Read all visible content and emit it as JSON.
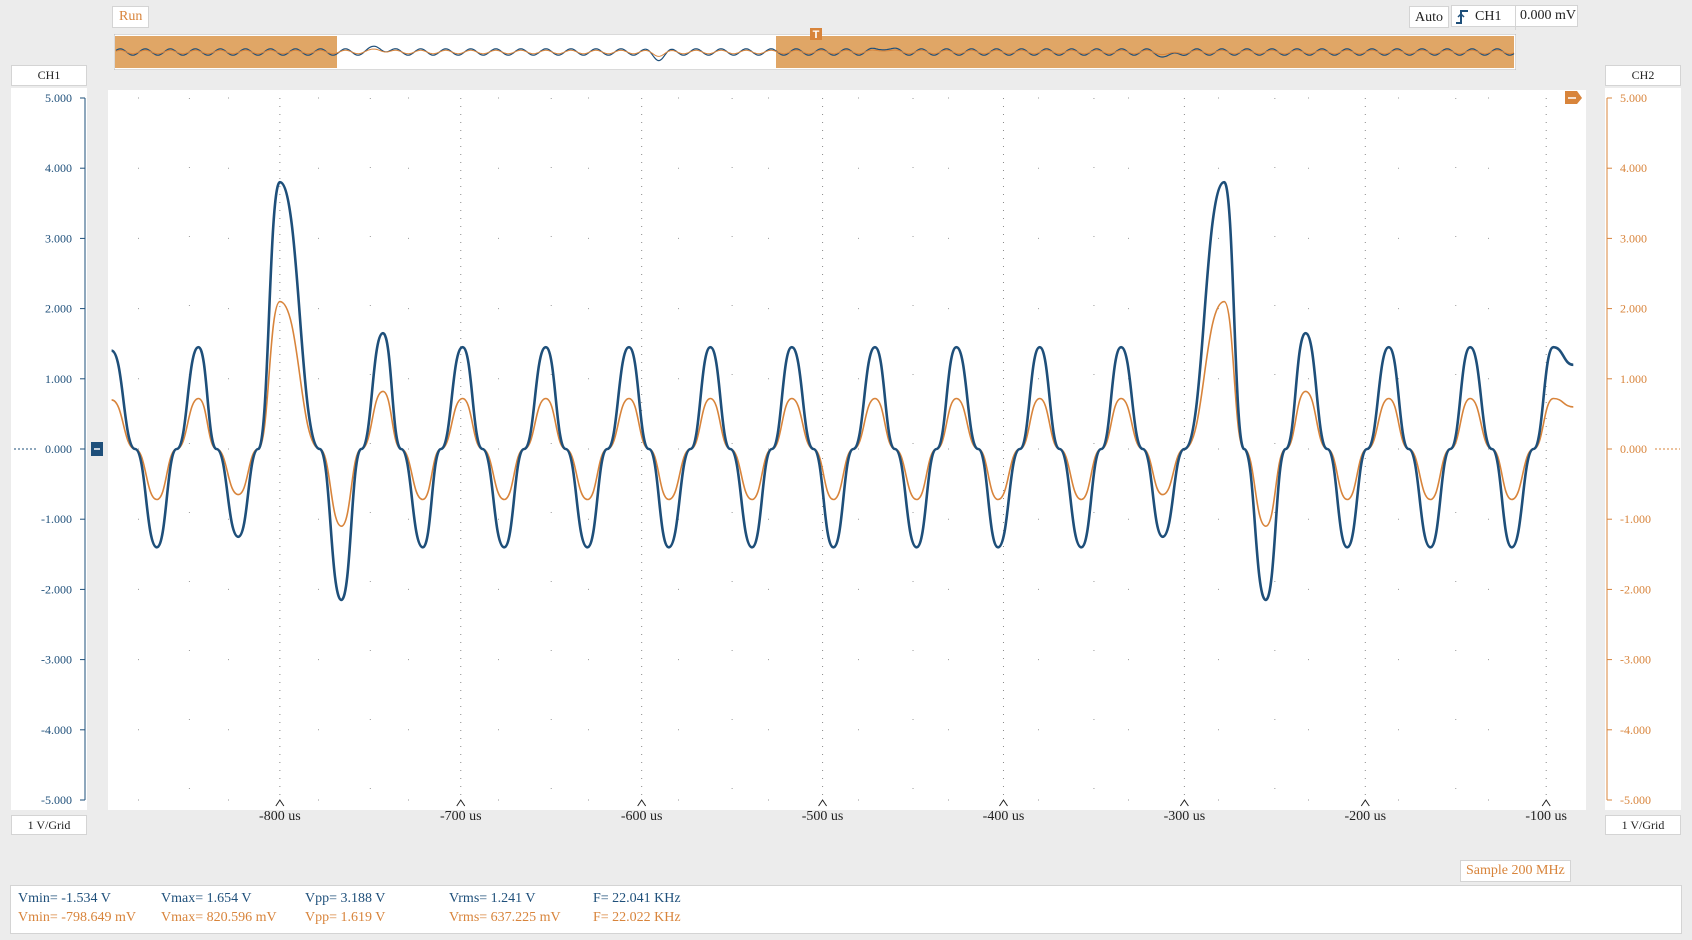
{
  "toolbar": {
    "run_state": "Run",
    "trigger_mode": "Auto",
    "trigger_source": "CH1",
    "trigger_level": "0.000 mV",
    "trigger_icon": "rising-edge-icon"
  },
  "channels": {
    "ch1": {
      "label": "CH1",
      "scale": "1 V/Grid",
      "color": "#1e4f7a"
    },
    "ch2": {
      "label": "CH2",
      "scale": "1 V/Grid",
      "color": "#d8843b"
    }
  },
  "sample_rate": "Sample 200 MHz",
  "measurements": {
    "ch1": {
      "vmin": "Vmin= -1.534 V",
      "vmax": "Vmax= 1.654 V",
      "vpp": "Vpp= 3.188 V",
      "vrms": "Vrms= 1.241 V",
      "freq": "F= 22.041 KHz"
    },
    "ch2": {
      "vmin": "Vmin= -798.649 mV",
      "vmax": "Vmax= 820.596 mV",
      "vpp": "Vpp= 1.619 V",
      "vrms": "Vrms= 637.225 mV",
      "freq": "F= 22.022 KHz"
    }
  },
  "markers": {
    "trigger_marker": "T"
  },
  "chart_data": {
    "type": "line",
    "title": "",
    "xlabel": "",
    "ylabel": "",
    "x_unit": "us",
    "y_unit": "V",
    "xlim": [
      -895,
      -78
    ],
    "ylim": [
      -5,
      5
    ],
    "x_ticks": [
      -800,
      -700,
      -600,
      -500,
      -400,
      -300,
      -200,
      -100
    ],
    "x_tick_labels": [
      "-800 us",
      "-700 us",
      "-600 us",
      "-500 us",
      "-400 us",
      "-300 us",
      "-200 us",
      "-100 us"
    ],
    "y_ticks": [
      5,
      4,
      3,
      2,
      1,
      0,
      -1,
      -2,
      -3,
      -4,
      -5
    ],
    "y_tick_labels": [
      "5.000",
      "4.000",
      "3.000",
      "2.000",
      "1.000",
      "0.000",
      "-1.000",
      "-2.000",
      "-3.000",
      "-4.000",
      "-5.000"
    ],
    "grid": true,
    "series": [
      {
        "name": "CH1",
        "color": "#1e4f7a",
        "x": [
          -893,
          -880,
          -868,
          -857,
          -845,
          -835,
          -823,
          -812,
          -800,
          -778,
          -766,
          -755,
          -743,
          -733,
          -721,
          -711,
          -699,
          -688,
          -676,
          -665,
          -653,
          -642,
          -630,
          -619,
          -607,
          -596,
          -585,
          -573,
          -562,
          -551,
          -539,
          -528,
          -517,
          -505,
          -494,
          -483,
          -471,
          -460,
          -448,
          -437,
          -426,
          -414,
          -403,
          -391,
          -380,
          -369,
          -357,
          -346,
          -335,
          -323,
          -312,
          -300,
          -278,
          -267,
          -255,
          -244,
          -233,
          -221,
          -210,
          -199,
          -187,
          -176,
          -164,
          -153,
          -142,
          -130,
          -119,
          -107,
          -96,
          -85
        ],
        "y": [
          1.4,
          0.0,
          -1.4,
          0.0,
          1.45,
          0.0,
          -1.25,
          0.0,
          3.8,
          0.0,
          -2.15,
          0.0,
          1.65,
          0.0,
          -1.4,
          0.0,
          1.45,
          0.0,
          -1.4,
          0.0,
          1.45,
          0.0,
          -1.4,
          0.0,
          1.45,
          0.0,
          -1.4,
          0.0,
          1.45,
          0.0,
          -1.4,
          0.0,
          1.45,
          0.0,
          -1.4,
          0.0,
          1.45,
          0.0,
          -1.4,
          0.0,
          1.45,
          0.0,
          -1.4,
          0.0,
          1.45,
          0.0,
          -1.4,
          0.0,
          1.45,
          0.0,
          -1.25,
          0.0,
          3.8,
          0.0,
          -2.15,
          0.0,
          1.65,
          0.0,
          -1.4,
          0.0,
          1.45,
          0.0,
          -1.4,
          0.0,
          1.45,
          0.0,
          -1.4,
          0.0,
          1.45,
          1.2
        ]
      },
      {
        "name": "CH2",
        "color": "#d8843b",
        "x": [
          -893,
          -880,
          -868,
          -857,
          -845,
          -835,
          -823,
          -812,
          -800,
          -778,
          -766,
          -755,
          -743,
          -733,
          -721,
          -711,
          -699,
          -688,
          -676,
          -665,
          -653,
          -642,
          -630,
          -619,
          -607,
          -596,
          -585,
          -573,
          -562,
          -551,
          -539,
          -528,
          -517,
          -505,
          -494,
          -483,
          -471,
          -460,
          -448,
          -437,
          -426,
          -414,
          -403,
          -391,
          -380,
          -369,
          -357,
          -346,
          -335,
          -323,
          -312,
          -300,
          -278,
          -267,
          -255,
          -244,
          -233,
          -221,
          -210,
          -199,
          -187,
          -176,
          -164,
          -153,
          -142,
          -130,
          -119,
          -107,
          -96,
          -85
        ],
        "y": [
          0.7,
          0.0,
          -0.72,
          0.0,
          0.72,
          0.0,
          -0.65,
          0.0,
          2.1,
          0.0,
          -1.1,
          0.0,
          0.82,
          0.0,
          -0.72,
          0.0,
          0.72,
          0.0,
          -0.72,
          0.0,
          0.72,
          0.0,
          -0.72,
          0.0,
          0.72,
          0.0,
          -0.72,
          0.0,
          0.72,
          0.0,
          -0.72,
          0.0,
          0.72,
          0.0,
          -0.72,
          0.0,
          0.72,
          0.0,
          -0.72,
          0.0,
          0.72,
          0.0,
          -0.72,
          0.0,
          0.72,
          0.0,
          -0.72,
          0.0,
          0.72,
          0.0,
          -0.65,
          0.0,
          2.1,
          0.0,
          -1.1,
          0.0,
          0.82,
          0.0,
          -0.72,
          0.0,
          0.72,
          0.0,
          -0.72,
          0.0,
          0.72,
          0.0,
          -0.72,
          0.0,
          0.72,
          0.6
        ]
      }
    ]
  }
}
